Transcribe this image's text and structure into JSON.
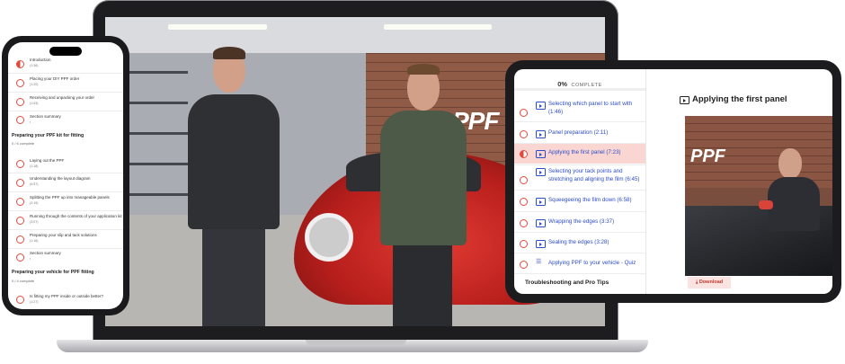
{
  "colors": {
    "accent": "#e24a3e",
    "link": "#2d4cc8",
    "active_row": "#f9d6d2"
  },
  "video_scene": {
    "wall_logo": "PPF"
  },
  "phone": {
    "top_items": [
      {
        "title": "Introduction",
        "sub": "(1:36)",
        "state": "half"
      },
      {
        "title": "Placing your DIY PPF order",
        "sub": "(1:20)",
        "state": "empty"
      },
      {
        "title": "Receiving and unpacking your order",
        "sub": "(1:03)",
        "state": "empty"
      },
      {
        "title": "Section summary",
        "sub": "",
        "state": "empty"
      }
    ],
    "section1": {
      "title": "Preparing your PPF kit for fitting",
      "count": "0 / 6 complete",
      "items": [
        {
          "title": "Laying out the PPF",
          "sub": "(1:18)"
        },
        {
          "title": "Understanding the layout diagram",
          "sub": "(0:57)"
        },
        {
          "title": "Splitting the PPF up into manageable panels",
          "sub": "(2:19)"
        },
        {
          "title": "Running through the contents of your application kit",
          "sub": "(3:07)"
        },
        {
          "title": "Preparing your slip and tack solutions",
          "sub": "(1:16)"
        },
        {
          "title": "Section summary",
          "sub": ""
        }
      ]
    },
    "section2": {
      "title": "Preparing your vehicle for PPF fitting",
      "count": "0 / 4 complete",
      "items": [
        {
          "title": "Is fitting my PPF inside or outside better?",
          "sub": "(1:27)"
        }
      ]
    }
  },
  "tablet": {
    "progress_pct": "0%",
    "progress_label": "COMPLETE",
    "lessons": [
      {
        "label": "Selecting which panel to start with (1:46)",
        "icon": "video",
        "state": "empty"
      },
      {
        "label": "Panel preparation (2:11)",
        "icon": "video",
        "state": "empty"
      },
      {
        "label": "Applying the first panel (7:23)",
        "icon": "video",
        "state": "active"
      },
      {
        "label": "Selecting your tack points and stretching and aligning the film (6:45)",
        "icon": "video",
        "state": "empty"
      },
      {
        "label": "Squeegeeing the film down (6:58)",
        "icon": "video",
        "state": "empty"
      },
      {
        "label": "Wrapping the edges (3:37)",
        "icon": "video",
        "state": "empty"
      },
      {
        "label": "Sealing the edges (3:28)",
        "icon": "video",
        "state": "empty"
      },
      {
        "label": "Applying PPF to your vehicle - Quiz",
        "icon": "quiz",
        "state": "empty"
      }
    ],
    "next_section": "Troubleshooting and Pro Tips",
    "main_title": "Applying the first panel",
    "video_logo": "PPF",
    "download_label": "⤓ Download"
  }
}
